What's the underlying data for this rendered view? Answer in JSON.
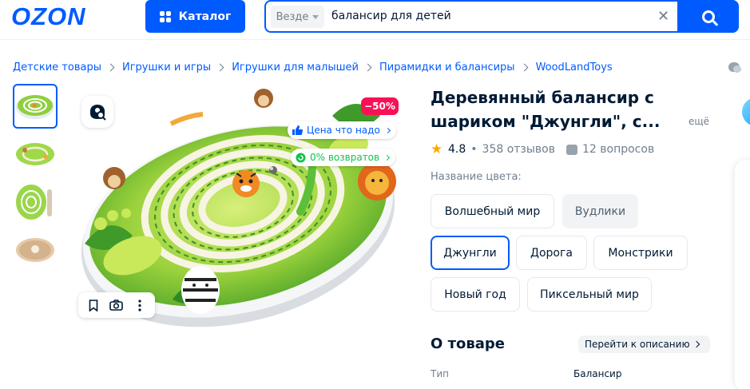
{
  "header": {
    "logo": "OZON",
    "catalog_label": "Каталог",
    "search": {
      "scope": "Везде",
      "value": "балансир для детей",
      "clear_icon": "close-icon",
      "submit_icon": "search-icon"
    }
  },
  "breadcrumbs": [
    "Детские товары",
    "Игрушки и игры",
    "Игрушки для малышей",
    "Пирамидки и балансиры",
    "WoodLandToys"
  ],
  "gallery": {
    "thumbnails": [
      "thumb-1",
      "thumb-2",
      "thumb-3",
      "thumb-4"
    ],
    "active_index": 0,
    "discount_badge": "−50%",
    "price_pill": "Цена что надо",
    "returns_pill": "0% возвратов",
    "tools": [
      "bookmark-icon",
      "camera-icon",
      "more-icon"
    ]
  },
  "product": {
    "title": "Деревянный балансир с шариком \"Джунгли\", с...",
    "more_label": "ещё",
    "rating": "4.8",
    "reviews": "358 отзывов",
    "questions": "12 вопросов",
    "color_label": "Название цвета:",
    "colors": [
      {
        "label": "Волшебный мир",
        "state": "normal"
      },
      {
        "label": "Вудлики",
        "state": "unavailable"
      },
      {
        "label": "Джунгли",
        "state": "selected"
      },
      {
        "label": "Дорога",
        "state": "normal"
      },
      {
        "label": "Монстрики",
        "state": "normal"
      },
      {
        "label": "Новый год",
        "state": "normal"
      },
      {
        "label": "Пиксельный мир",
        "state": "normal"
      }
    ],
    "about_title": "О товаре",
    "to_description": "Перейти к описанию",
    "attributes": [
      {
        "key": "Тип",
        "value": "Балансир"
      }
    ]
  },
  "colors": {
    "brand": "#005bff",
    "sale": "#f91155",
    "returns": "#10c44c",
    "star": "#ffa800"
  }
}
